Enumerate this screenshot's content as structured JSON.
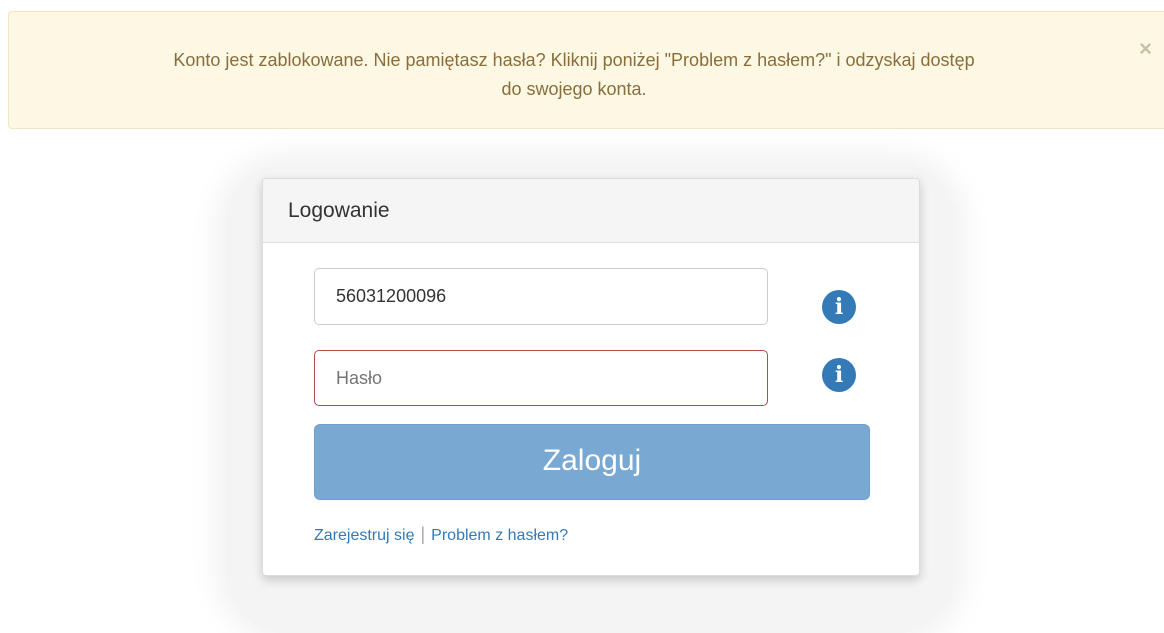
{
  "alert": {
    "message_line1": "Konto jest zablokowane. Nie pamiętasz hasła? Kliknij poniżej \"Problem z hasłem?\" i odzyskaj dostęp",
    "message_line2": "do swojego konta.",
    "close_symbol": "×",
    "background_color": "#fcf8e3",
    "text_color": "#8a6d3b"
  },
  "login_panel": {
    "title": "Logowanie",
    "login_field": {
      "value": "56031200096"
    },
    "password_field": {
      "value": "",
      "placeholder": "Hasło",
      "border_color": "#b94a48"
    },
    "info_icon_symbol": "i",
    "info_icon_name": "info-circle-icon",
    "submit_label": "Zaloguj",
    "submit_color": "#79a9d2",
    "links": {
      "register": "Zarejestruj się",
      "separator": "|",
      "password_problem": "Problem z hasłem?"
    },
    "link_color": "#337ab7"
  }
}
